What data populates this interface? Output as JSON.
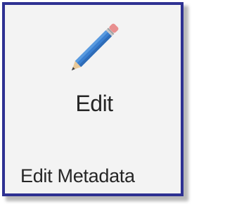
{
  "ribbon_group": {
    "edit_button_label": "Edit",
    "group_label": "Edit Metadata",
    "edit_button_icon": "pencil-icon"
  },
  "colors": {
    "frame_border": "#2e3192",
    "panel_background": "#f3f3f3",
    "pencil_body": "#3a7fd0",
    "pencil_eraser": "#e88f8f",
    "text": "#262626"
  }
}
